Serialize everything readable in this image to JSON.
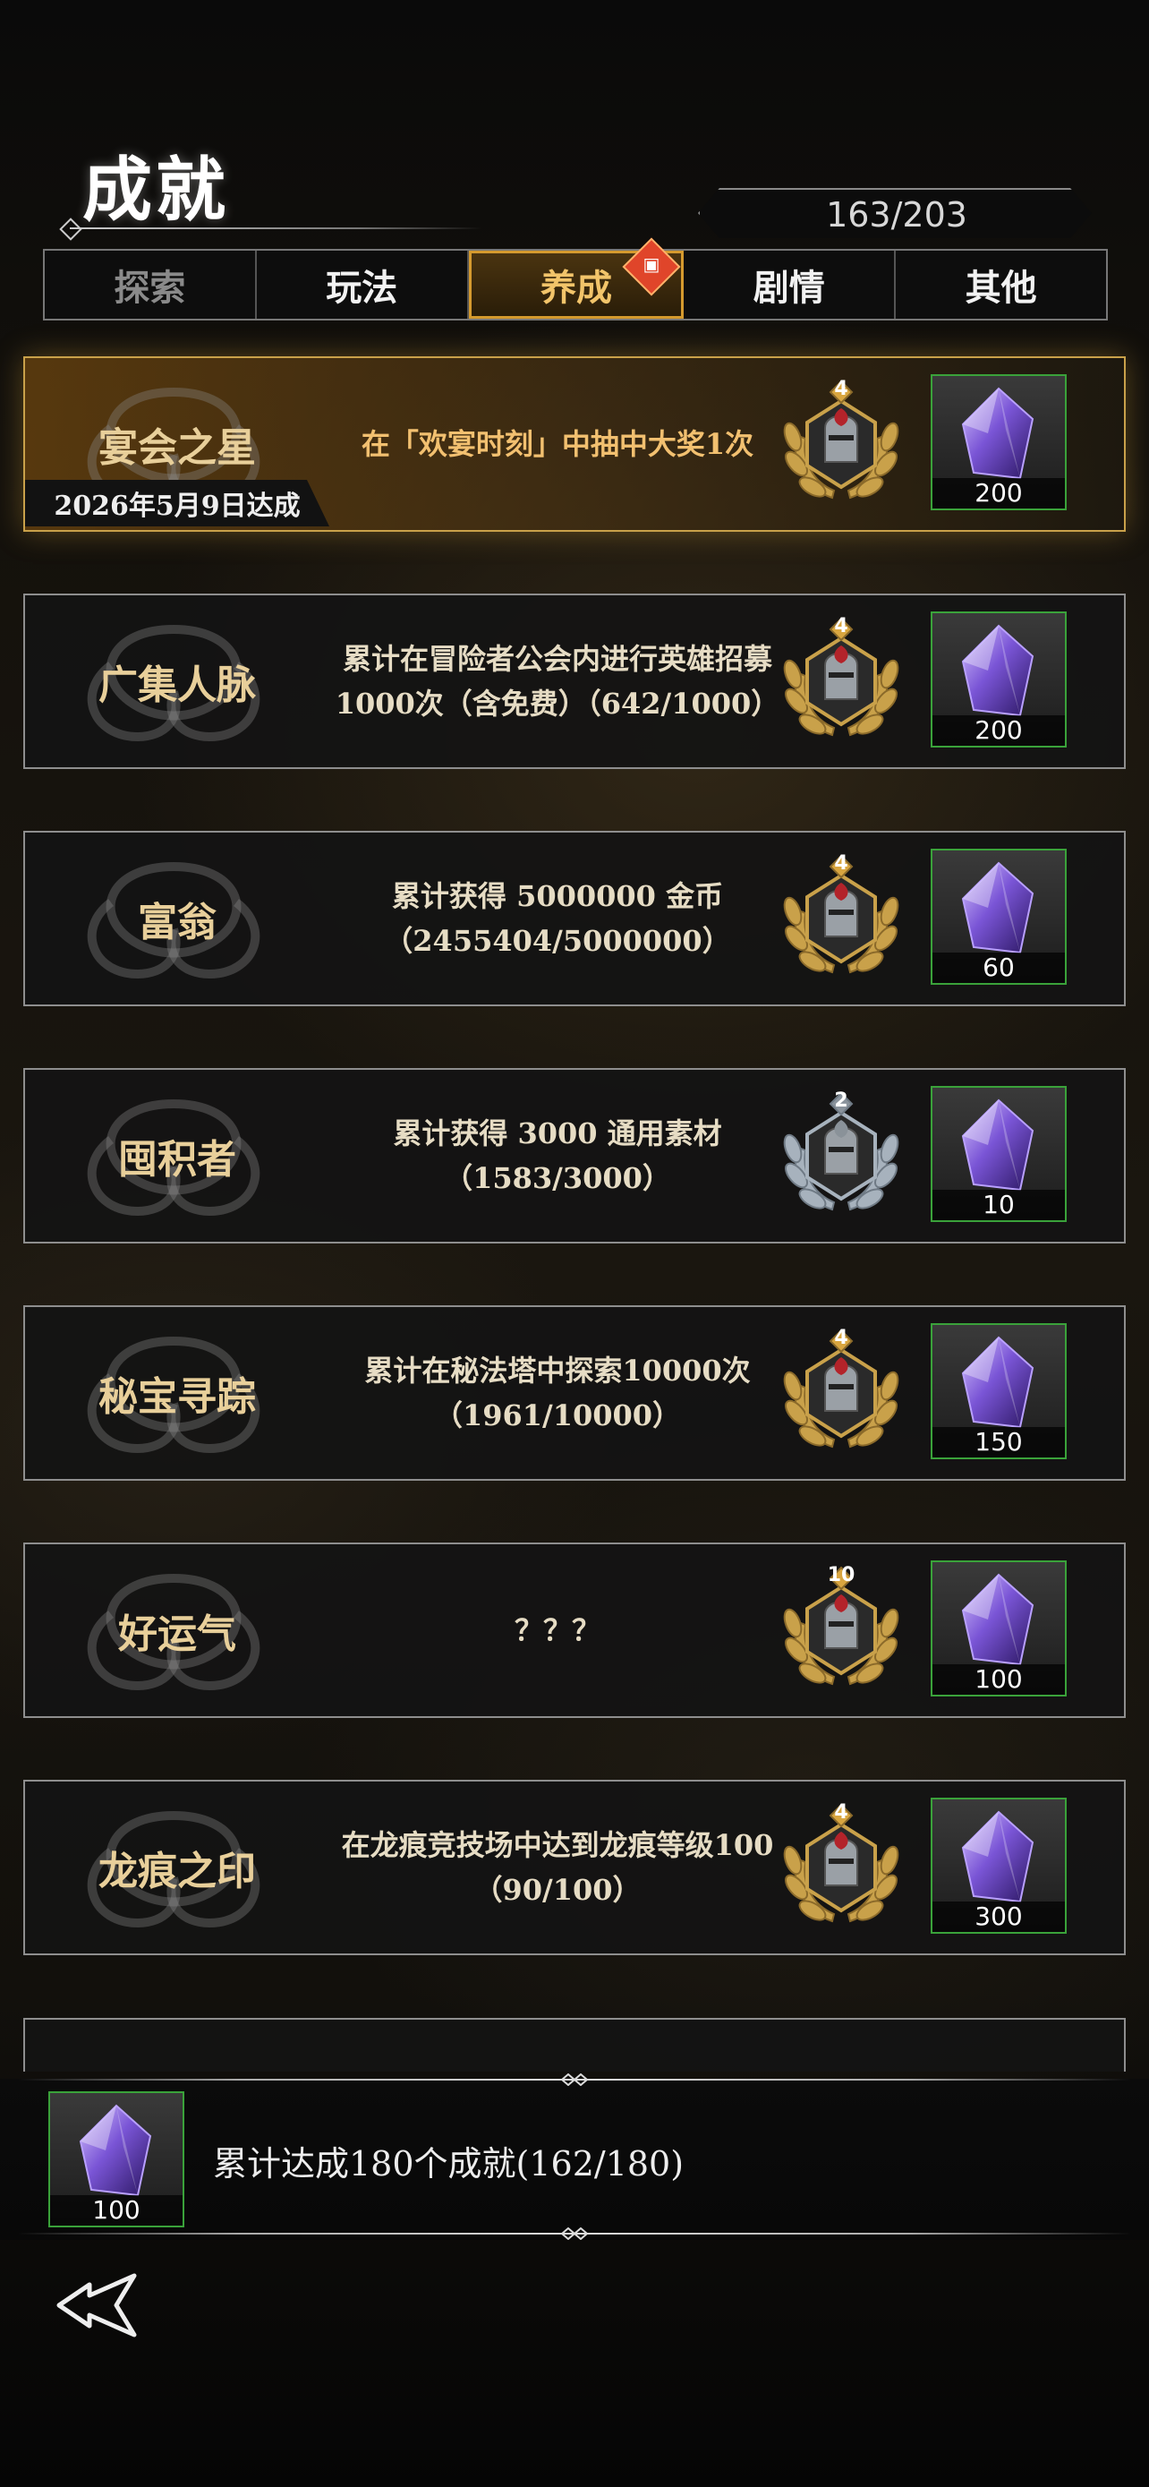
{
  "header": {
    "title": "成就",
    "progress": "163/203"
  },
  "tabs": [
    {
      "label": "探索",
      "state": "disabled"
    },
    {
      "label": "玩法",
      "state": "normal"
    },
    {
      "label": "养成",
      "state": "active",
      "badge": "gift-icon"
    },
    {
      "label": "剧情",
      "state": "normal"
    },
    {
      "label": "其他",
      "state": "normal"
    }
  ],
  "achievements": [
    {
      "name": "宴会之星",
      "desc": "在「欢宴时刻」中抽中大奖1次",
      "medal_level": "4",
      "medal": "gold",
      "reward": "200",
      "date": "2026年5月9日达成",
      "highlight": true
    },
    {
      "name": "广集人脉",
      "desc": "累计在冒险者公会内进行英雄招募1000次（含免费）（642/1000）",
      "medal_level": "4",
      "medal": "gold",
      "reward": "200"
    },
    {
      "name": "富翁",
      "desc": "累计获得 5000000 金币（2455404/5000000）",
      "medal_level": "4",
      "medal": "gold",
      "reward": "60"
    },
    {
      "name": "囤积者",
      "desc": "累计获得 3000 通用素材（1583/3000）",
      "medal_level": "2",
      "medal": "silver",
      "reward": "10"
    },
    {
      "name": "秘宝寻踪",
      "desc": "累计在秘法塔中探索10000次（1961/10000）",
      "medal_level": "4",
      "medal": "gold",
      "reward": "150"
    },
    {
      "name": "好运气",
      "desc": "？？？",
      "medal_level": "10",
      "medal": "gold",
      "reward": "100"
    },
    {
      "name": "龙痕之印",
      "desc": "在龙痕竞技场中达到龙痕等级100（90/100）",
      "medal_level": "4",
      "medal": "gold",
      "reward": "300"
    }
  ],
  "footer": {
    "reward": "100",
    "text": "累计达成180个成就(162/180)"
  },
  "colors": {
    "gold": "#c9a14a",
    "green_border": "#3aa23a",
    "active_tab": "#d59a2e"
  }
}
